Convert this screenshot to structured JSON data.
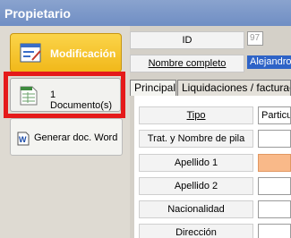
{
  "window": {
    "title": "Propietario"
  },
  "sidebar": {
    "modificacion": {
      "label": "Modificación",
      "icon": "edit-form-icon"
    },
    "documentos": {
      "label": "1 Documento(s)",
      "icon": "spreadsheet-document-icon"
    },
    "generar_word": {
      "label": "Generar doc. Word",
      "icon": "word-document-icon"
    }
  },
  "header": {
    "id_label": "ID",
    "id_value": "97",
    "nombre_label": "Nombre completo",
    "nombre_value": "Alejandro"
  },
  "tabs": [
    {
      "label": "Principal",
      "active": true
    },
    {
      "label": "Liquidaciones / facturació",
      "active": false
    }
  ],
  "fields": [
    {
      "label": "Tipo",
      "value": "Particu"
    },
    {
      "label": "Trat. y Nombre de pila",
      "value": ""
    },
    {
      "label": "Apellido 1",
      "value": ""
    },
    {
      "label": "Apellido 2",
      "value": ""
    },
    {
      "label": "Nacionalidad",
      "value": ""
    },
    {
      "label": "Dirección",
      "value": ""
    }
  ],
  "colors": {
    "title_bar": "#7b98c9",
    "highlight_button": "#f6c42c",
    "highlight_border": "#e51a1a",
    "selected_text": "#2e63c7",
    "required_field": "#f9b989"
  }
}
